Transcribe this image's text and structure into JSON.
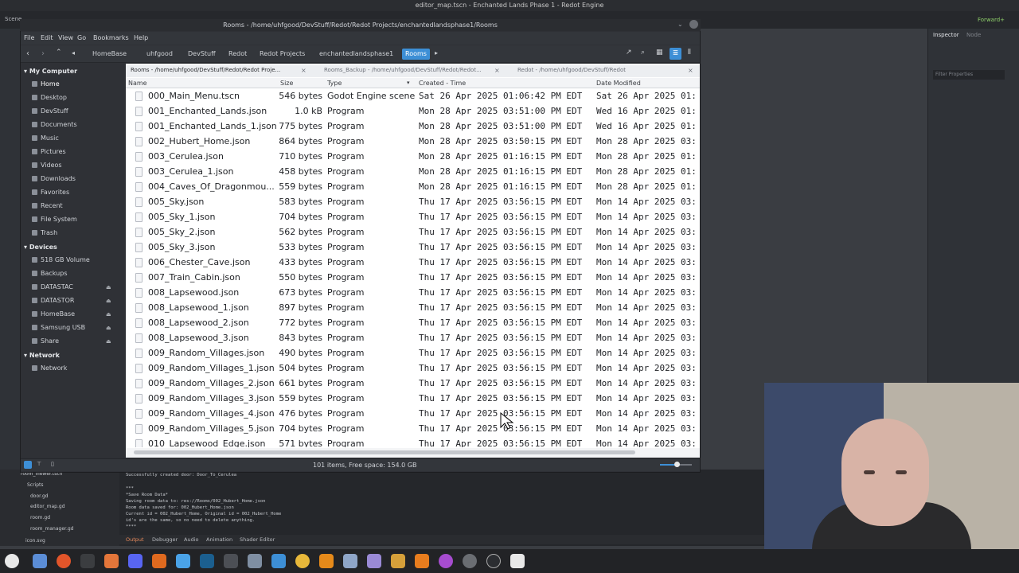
{
  "bg_window_title": "editor_map.tscn - Enchanted Lands Phase 1 - Redot Engine",
  "godot": {
    "inspector_tab": "Inspector",
    "node_tab": "Node",
    "filter_placeholder": "Filter Properties",
    "forward_label": "Forward+",
    "scene_tab": "Scene",
    "filesystem_items": [
      "room_viewer.tscn",
      "Scripts",
      "door.gd",
      "editor_map.gd",
      "room.gd",
      "room_manager.gd",
      "icon.svg"
    ],
    "output_lines": [
      "Successfully created door: Door_To_Cerulea",
      "",
      "***",
      "*Save Room Data*",
      "Saving room data to: res://Rooms/002_Hubert_Home.json",
      "Room data saved for: 002_Hubert_Home.json",
      "Current id = 002_Hubert_Home, Original id = 002_Hubert_Home",
      "id's are the same, so no need to delete anything.",
      "****"
    ],
    "output_tabs": [
      "Output",
      "Debugger",
      "Audio",
      "Animation",
      "Shader Editor"
    ]
  },
  "fm": {
    "title": "Rooms - /home/uhfgood/DevStuff/Redot/Redot Projects/enchantedlandsphase1/Rooms",
    "menu": [
      "File",
      "Edit",
      "View",
      "Go",
      "Bookmarks",
      "Help"
    ],
    "breadcrumbs": [
      "HomeBase",
      "uhfgood",
      "DevStuff",
      "Redot",
      "Redot Projects",
      "enchantedlandsphase1",
      "Rooms"
    ],
    "sidebar": {
      "my_computer": "My Computer",
      "places": [
        "Home",
        "Desktop",
        "DevStuff",
        "Documents",
        "Music",
        "Pictures",
        "Videos",
        "Downloads",
        "Favorites",
        "Recent",
        "File System",
        "Trash"
      ],
      "devices_head": "Devices",
      "devices": [
        "518 GB Volume",
        "Backups",
        "DATASTAC",
        "DATASTOR",
        "HomeBase",
        "Samsung USB",
        "Share"
      ],
      "network_head": "Network",
      "network": [
        "Network"
      ]
    },
    "tabs": [
      "Rooms - /home/uhfgood/DevStuff/Redot/Redot Proje...",
      "Rooms_Backup - /home/uhfgood/DevStuff/Redot/Redot...",
      "Redot - /home/uhfgood/DevStuff/Redot"
    ],
    "columns": [
      "Name",
      "Size",
      "Type",
      "Created - Time",
      "Date Modified"
    ],
    "files": [
      [
        "000_Main_Menu.tscn",
        "546 bytes",
        "Godot Engine scene",
        "Sat 26 Apr 2025 01:06:42 PM EDT",
        "Sat 26 Apr 2025 01:"
      ],
      [
        "001_Enchanted_Lands.json",
        "1.0 kB",
        "Program",
        "Mon 28 Apr 2025 03:51:00 PM EDT",
        "Wed 16 Apr 2025 01:"
      ],
      [
        "001_Enchanted_Lands_1.json",
        "775 bytes",
        "Program",
        "Mon 28 Apr 2025 03:51:00 PM EDT",
        "Wed 16 Apr 2025 01:"
      ],
      [
        "002_Hubert_Home.json",
        "864 bytes",
        "Program",
        "Mon 28 Apr 2025 03:50:15 PM EDT",
        "Mon 28 Apr 2025 03:"
      ],
      [
        "003_Cerulea.json",
        "710 bytes",
        "Program",
        "Mon 28 Apr 2025 01:16:15 PM EDT",
        "Mon 28 Apr 2025 01:"
      ],
      [
        "003_Cerulea_1.json",
        "458 bytes",
        "Program",
        "Mon 28 Apr 2025 01:16:15 PM EDT",
        "Mon 28 Apr 2025 01:"
      ],
      [
        "004_Caves_Of_Dragonmou...",
        "559 bytes",
        "Program",
        "Mon 28 Apr 2025 01:16:15 PM EDT",
        "Mon 28 Apr 2025 01:"
      ],
      [
        "005_Sky.json",
        "583 bytes",
        "Program",
        "Thu 17 Apr 2025 03:56:15 PM EDT",
        "Mon 14 Apr 2025 03:"
      ],
      [
        "005_Sky_1.json",
        "704 bytes",
        "Program",
        "Thu 17 Apr 2025 03:56:15 PM EDT",
        "Mon 14 Apr 2025 03:"
      ],
      [
        "005_Sky_2.json",
        "562 bytes",
        "Program",
        "Thu 17 Apr 2025 03:56:15 PM EDT",
        "Mon 14 Apr 2025 03:"
      ],
      [
        "005_Sky_3.json",
        "533 bytes",
        "Program",
        "Thu 17 Apr 2025 03:56:15 PM EDT",
        "Mon 14 Apr 2025 03:"
      ],
      [
        "006_Chester_Cave.json",
        "433 bytes",
        "Program",
        "Thu 17 Apr 2025 03:56:15 PM EDT",
        "Mon 14 Apr 2025 03:"
      ],
      [
        "007_Train_Cabin.json",
        "550 bytes",
        "Program",
        "Thu 17 Apr 2025 03:56:15 PM EDT",
        "Mon 14 Apr 2025 03:"
      ],
      [
        "008_Lapsewood.json",
        "673 bytes",
        "Program",
        "Thu 17 Apr 2025 03:56:15 PM EDT",
        "Mon 14 Apr 2025 03:"
      ],
      [
        "008_Lapsewood_1.json",
        "897 bytes",
        "Program",
        "Thu 17 Apr 2025 03:56:15 PM EDT",
        "Mon 14 Apr 2025 03:"
      ],
      [
        "008_Lapsewood_2.json",
        "772 bytes",
        "Program",
        "Thu 17 Apr 2025 03:56:15 PM EDT",
        "Mon 14 Apr 2025 03:"
      ],
      [
        "008_Lapsewood_3.json",
        "843 bytes",
        "Program",
        "Thu 17 Apr 2025 03:56:15 PM EDT",
        "Mon 14 Apr 2025 03:"
      ],
      [
        "009_Random_Villages.json",
        "490 bytes",
        "Program",
        "Thu 17 Apr 2025 03:56:15 PM EDT",
        "Mon 14 Apr 2025 03:"
      ],
      [
        "009_Random_Villages_1.json",
        "504 bytes",
        "Program",
        "Thu 17 Apr 2025 03:56:15 PM EDT",
        "Mon 14 Apr 2025 03:"
      ],
      [
        "009_Random_Villages_2.json",
        "661 bytes",
        "Program",
        "Thu 17 Apr 2025 03:56:15 PM EDT",
        "Mon 14 Apr 2025 03:"
      ],
      [
        "009_Random_Villages_3.json",
        "559 bytes",
        "Program",
        "Thu 17 Apr 2025 03:56:15 PM EDT",
        "Mon 14 Apr 2025 03:"
      ],
      [
        "009_Random_Villages_4.json",
        "476 bytes",
        "Program",
        "Thu 17 Apr 2025 03:56:15 PM EDT",
        "Mon 14 Apr 2025 03:"
      ],
      [
        "009_Random_Villages_5.json",
        "704 bytes",
        "Program",
        "Thu 17 Apr 2025 03:56:15 PM EDT",
        "Mon 14 Apr 2025 03:"
      ],
      [
        "010_Lapsewood_Edge.json",
        "571 bytes",
        "Program",
        "Thu 17 Apr 2025 03:56:15 PM EDT",
        "Mon 14 Apr 2025 03:"
      ]
    ],
    "status": "101 items, Free space: 154.0 GB"
  },
  "colors": {
    "accent": "#3d8fd6",
    "window_bg": "#2f3136",
    "list_bg": "#ffffff"
  }
}
